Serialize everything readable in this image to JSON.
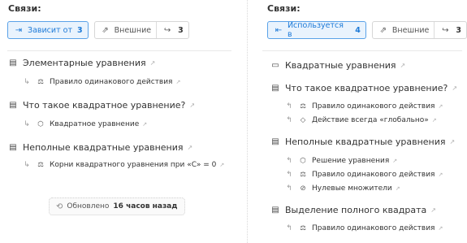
{
  "left": {
    "section_title": "Связи:",
    "depends_button": {
      "label": "Зависит от",
      "count": "3",
      "icon": "arrow-right-into-icon"
    },
    "external_button": {
      "label": "Внешние",
      "count": "3",
      "icon": "external-link-icon"
    },
    "groups": [
      {
        "title": "Элементарные уравнения",
        "items": [
          {
            "relation": "↳",
            "icon": "gavel-icon",
            "glyph": "⚖",
            "label": "Правило одинакового действия"
          }
        ]
      },
      {
        "title": "Что такое квадратное уравнение?",
        "items": [
          {
            "relation": "↳",
            "icon": "cube-icon",
            "glyph": "⬡",
            "label": "Квадратное уравнение"
          }
        ]
      },
      {
        "title": "Неполные квадратные уравнения",
        "items": [
          {
            "relation": "↳",
            "icon": "gavel-icon",
            "glyph": "⚖",
            "label": "Корни квадратного уравнения при «C» = 0"
          }
        ]
      }
    ],
    "updated": {
      "prefix": "Обновлено",
      "value": "16 часов назад"
    }
  },
  "right": {
    "section_title": "Связи:",
    "used_in_button": {
      "label": "Используется в",
      "count": "4",
      "icon": "arrow-left-from-icon"
    },
    "external_button": {
      "label": "Внешние",
      "count": "3",
      "icon": "external-link-icon"
    },
    "groups": [
      {
        "title": "Квадратные уравнения",
        "icon": "folder-icon",
        "items": []
      },
      {
        "title": "Что такое квадратное уравнение?",
        "icon": "book-icon",
        "items": [
          {
            "relation": "↰",
            "icon": "gavel-icon",
            "glyph": "⚖",
            "label": "Правило одинакового действия"
          },
          {
            "relation": "↰",
            "icon": "diamond-icon",
            "glyph": "◇",
            "label": "Действие всегда «глобально»"
          }
        ]
      },
      {
        "title": "Неполные квадратные уравнения",
        "icon": "book-icon",
        "items": [
          {
            "relation": "↰",
            "icon": "cube-icon",
            "glyph": "⬡",
            "label": "Решение уравнения"
          },
          {
            "relation": "↰",
            "icon": "gavel-icon",
            "glyph": "⚖",
            "label": "Правило одинакового действия"
          },
          {
            "relation": "↰",
            "icon": "check-circle-icon",
            "glyph": "⊘",
            "label": "Нулевые множители"
          }
        ]
      },
      {
        "title": "Выделение полного квадрата",
        "icon": "book-icon",
        "items": [
          {
            "relation": "↰",
            "icon": "gavel-icon",
            "glyph": "⚖",
            "label": "Правило одинакового действия"
          }
        ]
      }
    ]
  }
}
